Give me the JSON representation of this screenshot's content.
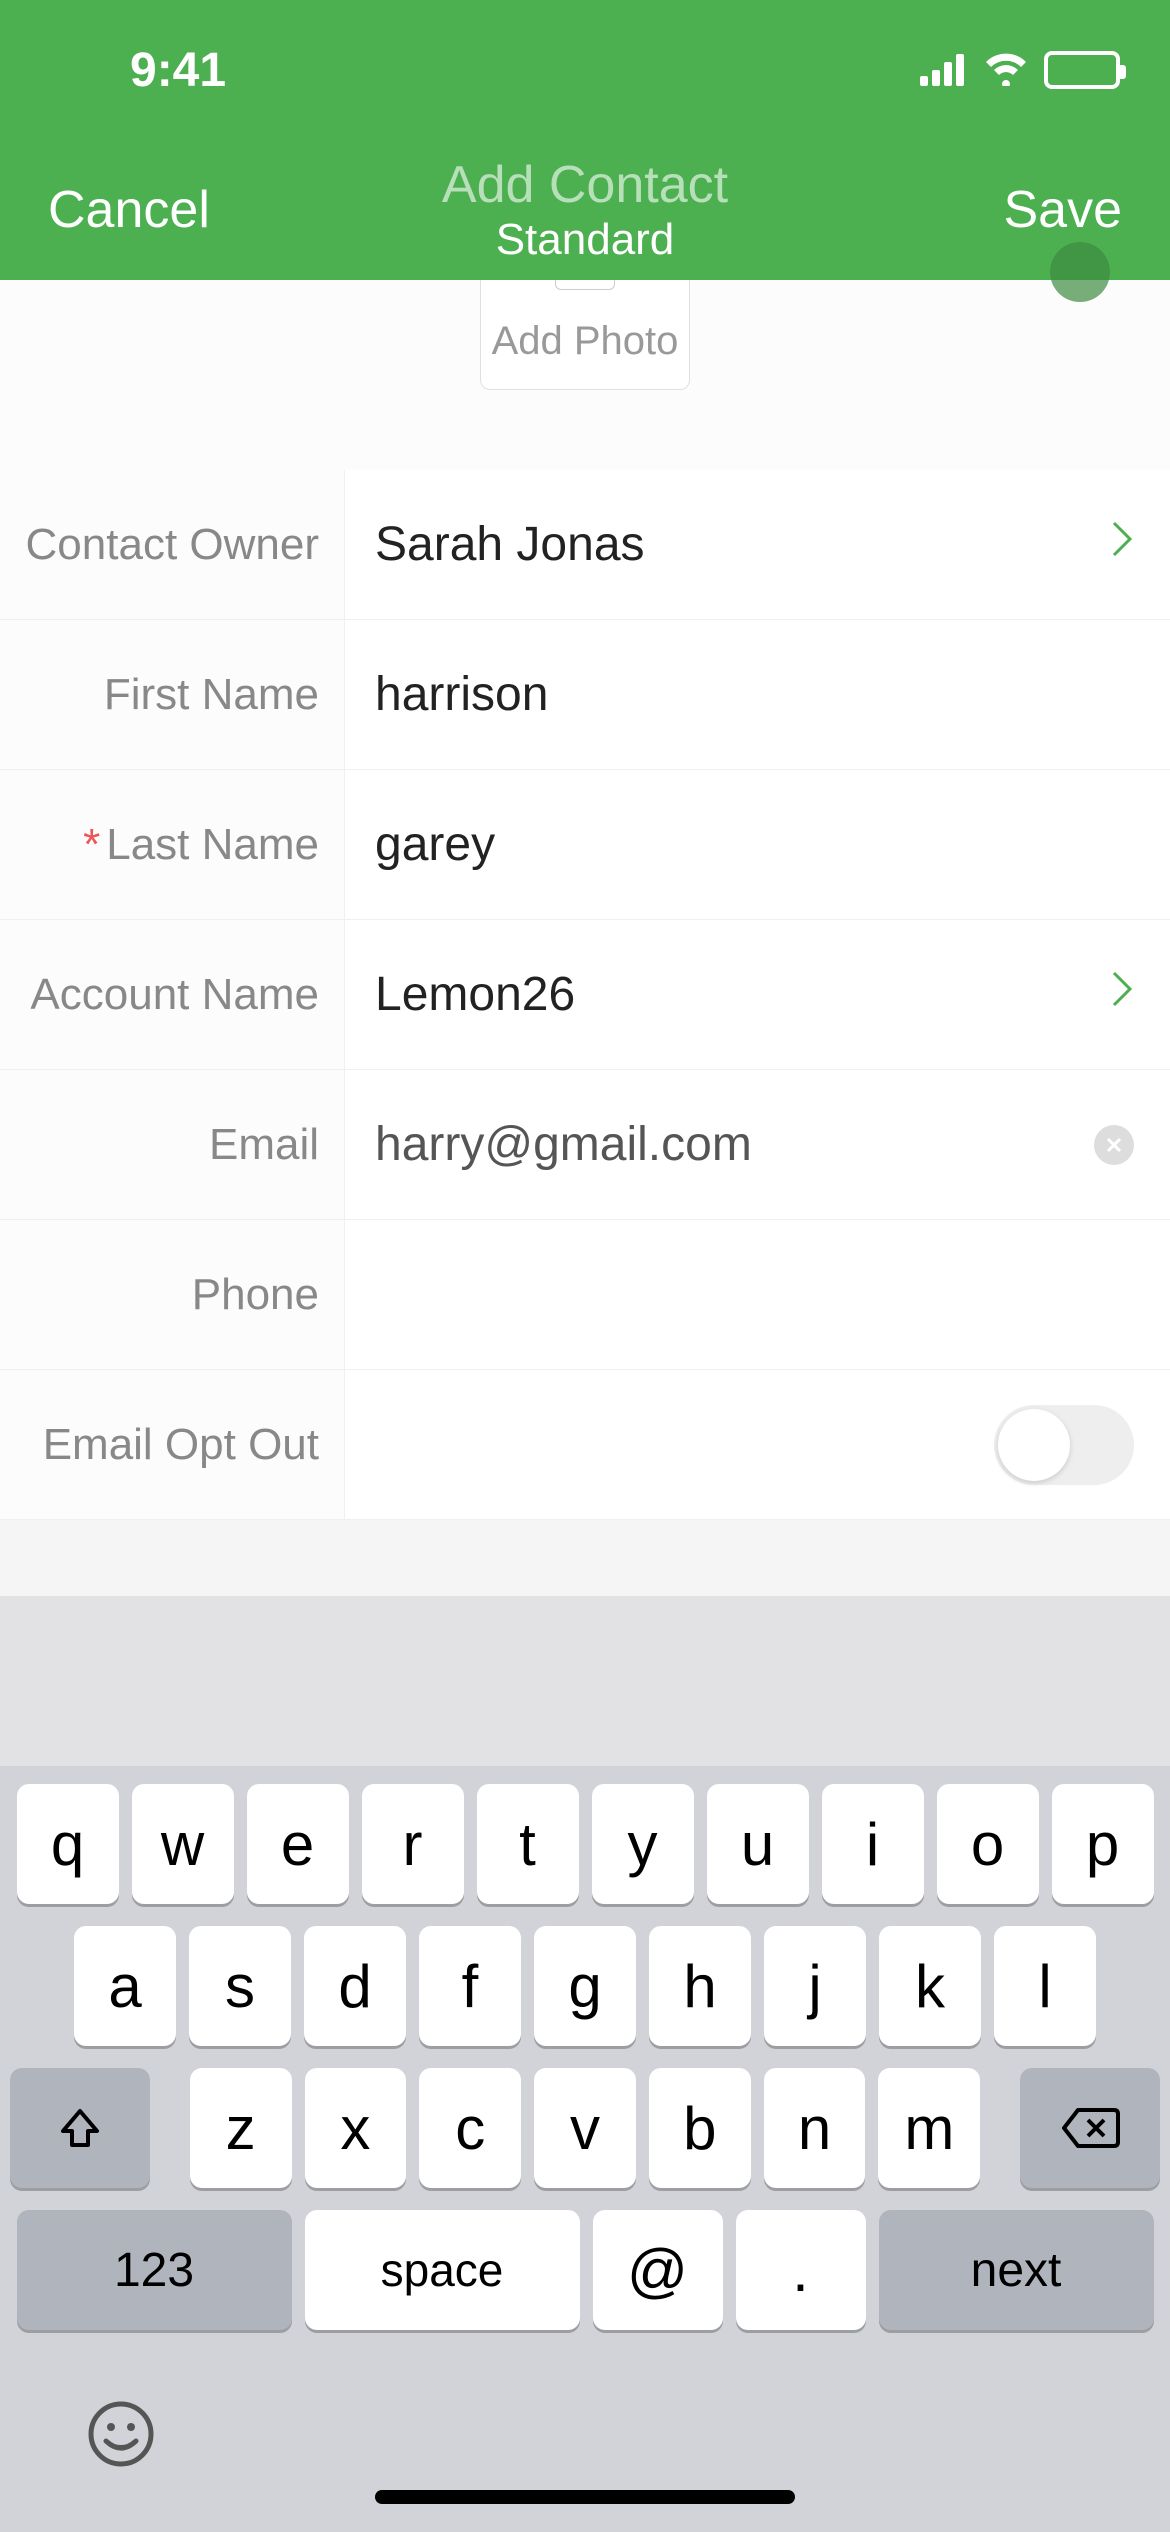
{
  "status": {
    "time": "9:41"
  },
  "nav": {
    "cancel": "Cancel",
    "save": "Save",
    "title": "Add Contact",
    "subtitle": "Standard"
  },
  "photo": {
    "label": "Add Photo"
  },
  "form": {
    "owner_label": "Contact Owner",
    "owner_value": "Sarah Jonas",
    "first_name_label": "First Name",
    "first_name_value": "harrison",
    "last_name_label": "Last Name",
    "last_name_value": "garey",
    "account_label": "Account Name",
    "account_value": "Lemon26",
    "email_label": "Email",
    "email_value": "harry@gmail.com",
    "phone_label": "Phone",
    "phone_value": "",
    "optout_label": "Email Opt Out"
  },
  "keyboard": {
    "row1": [
      "q",
      "w",
      "e",
      "r",
      "t",
      "y",
      "u",
      "i",
      "o",
      "p"
    ],
    "row2": [
      "a",
      "s",
      "d",
      "f",
      "g",
      "h",
      "j",
      "k",
      "l"
    ],
    "row3": [
      "z",
      "x",
      "c",
      "v",
      "b",
      "n",
      "m"
    ],
    "k123": "123",
    "space": "space",
    "at": "@",
    "dot": ".",
    "next": "next"
  }
}
